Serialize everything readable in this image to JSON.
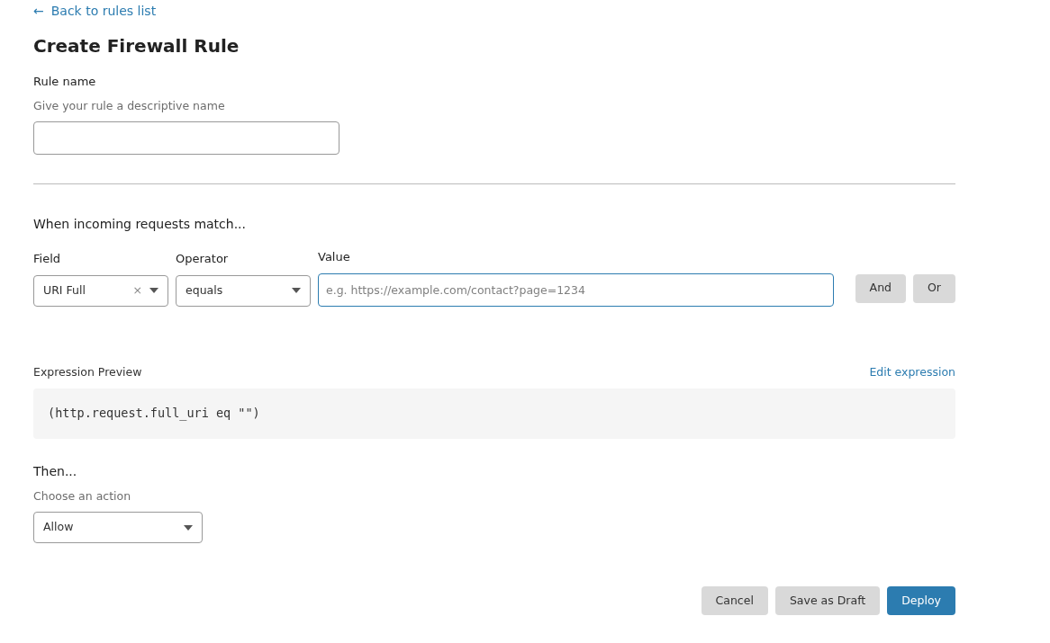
{
  "back_link": {
    "arrow": "←",
    "label": "Back to rules list"
  },
  "title": "Create Firewall Rule",
  "rule_name": {
    "label": "Rule name",
    "hint": "Give your rule a descriptive name"
  },
  "match": {
    "heading": "When incoming requests match...",
    "field": {
      "label": "Field",
      "value": "URI Full",
      "clear": "×"
    },
    "operator": {
      "label": "Operator",
      "value": "equals"
    },
    "value": {
      "label": "Value",
      "placeholder": "e.g. https://example.com/contact?page=1234",
      "focused": true
    },
    "logic_buttons": [
      "And",
      "Or"
    ]
  },
  "expression": {
    "label": "Expression Preview",
    "edit_link": "Edit expression",
    "code": "(http.request.full_uri eq \"\")"
  },
  "then": {
    "heading": "Then...",
    "hint": "Choose an action",
    "action": "Allow"
  },
  "buttons": [
    {
      "label": "Cancel",
      "kind": "secondary"
    },
    {
      "label": "Save as Draft",
      "kind": "secondary"
    },
    {
      "label": "Deploy",
      "kind": "primary"
    }
  ]
}
